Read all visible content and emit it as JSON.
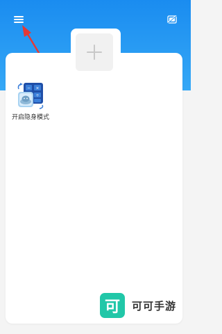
{
  "header": {
    "menu_icon": "menu-icon",
    "right_icon": "hide-toggle-icon",
    "gradient_top": "#1a8cf0",
    "gradient_bottom": "#35a8f6"
  },
  "workspace": {
    "add_icon": "plus-icon",
    "apps": [
      {
        "label": "开启隐身模式",
        "icon": "calculator-icon"
      }
    ]
  },
  "annotation": {
    "arrow_color": "#e53935"
  },
  "watermark": {
    "logo_char": "可",
    "text": "可可手游",
    "color": "#21c7a8"
  }
}
